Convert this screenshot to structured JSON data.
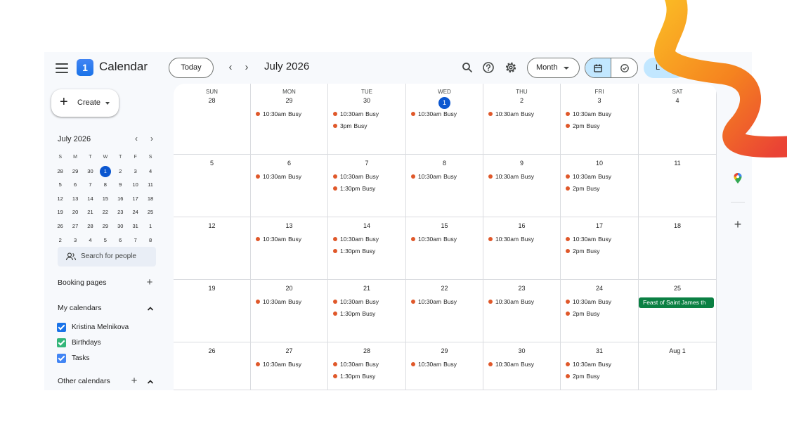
{
  "header": {
    "app_title": "Calendar",
    "logo_number": "1",
    "today_label": "Today",
    "period_label": "July 2026",
    "view_label": "Month",
    "account_initial": "L"
  },
  "sidebar": {
    "create_label": "Create",
    "mini_calendar": {
      "title": "July 2026",
      "weekdays": [
        "S",
        "M",
        "T",
        "W",
        "T",
        "F",
        "S"
      ],
      "weeks": [
        [
          "28",
          "29",
          "30",
          "1",
          "2",
          "3",
          "4"
        ],
        [
          "5",
          "6",
          "7",
          "8",
          "9",
          "10",
          "11"
        ],
        [
          "12",
          "13",
          "14",
          "15",
          "16",
          "17",
          "18"
        ],
        [
          "19",
          "20",
          "21",
          "22",
          "23",
          "24",
          "25"
        ],
        [
          "26",
          "27",
          "28",
          "29",
          "30",
          "31",
          "1"
        ],
        [
          "2",
          "3",
          "4",
          "5",
          "6",
          "7",
          "8"
        ]
      ],
      "selected": "1"
    },
    "search_people_placeholder": "Search for people",
    "booking_pages_label": "Booking pages",
    "my_calendars_label": "My calendars",
    "my_calendars": [
      {
        "name": "Kristina Melnikova",
        "color": "#1a73e8"
      },
      {
        "name": "Birthdays",
        "color": "#33b679"
      },
      {
        "name": "Tasks",
        "color": "#4285f4"
      }
    ],
    "other_calendars_label": "Other calendars"
  },
  "calendar": {
    "weekday_headers": [
      "SUN",
      "MON",
      "TUE",
      "WED",
      "THU",
      "FRI",
      "SAT"
    ],
    "weeks": [
      [
        {
          "day": "28",
          "events": []
        },
        {
          "day": "29",
          "events": [
            {
              "time": "10:30am",
              "title": "Busy"
            }
          ]
        },
        {
          "day": "30",
          "events": [
            {
              "time": "10:30am",
              "title": "Busy"
            },
            {
              "time": "3pm",
              "title": "Busy"
            }
          ]
        },
        {
          "day": "1",
          "today": true,
          "events": [
            {
              "time": "10:30am",
              "title": "Busy"
            }
          ]
        },
        {
          "day": "2",
          "events": [
            {
              "time": "10:30am",
              "title": "Busy"
            }
          ]
        },
        {
          "day": "3",
          "events": [
            {
              "time": "10:30am",
              "title": "Busy"
            },
            {
              "time": "2pm",
              "title": "Busy"
            }
          ]
        },
        {
          "day": "4",
          "events": []
        }
      ],
      [
        {
          "day": "5",
          "events": []
        },
        {
          "day": "6",
          "events": [
            {
              "time": "10:30am",
              "title": "Busy"
            }
          ]
        },
        {
          "day": "7",
          "events": [
            {
              "time": "10:30am",
              "title": "Busy"
            },
            {
              "time": "1:30pm",
              "title": "Busy"
            }
          ]
        },
        {
          "day": "8",
          "events": [
            {
              "time": "10:30am",
              "title": "Busy"
            }
          ]
        },
        {
          "day": "9",
          "events": [
            {
              "time": "10:30am",
              "title": "Busy"
            }
          ]
        },
        {
          "day": "10",
          "events": [
            {
              "time": "10:30am",
              "title": "Busy"
            },
            {
              "time": "2pm",
              "title": "Busy"
            }
          ]
        },
        {
          "day": "11",
          "events": []
        }
      ],
      [
        {
          "day": "12",
          "events": []
        },
        {
          "day": "13",
          "events": [
            {
              "time": "10:30am",
              "title": "Busy"
            }
          ]
        },
        {
          "day": "14",
          "events": [
            {
              "time": "10:30am",
              "title": "Busy"
            },
            {
              "time": "1:30pm",
              "title": "Busy"
            }
          ]
        },
        {
          "day": "15",
          "events": [
            {
              "time": "10:30am",
              "title": "Busy"
            }
          ]
        },
        {
          "day": "16",
          "events": [
            {
              "time": "10:30am",
              "title": "Busy"
            }
          ]
        },
        {
          "day": "17",
          "events": [
            {
              "time": "10:30am",
              "title": "Busy"
            },
            {
              "time": "2pm",
              "title": "Busy"
            }
          ]
        },
        {
          "day": "18",
          "events": []
        }
      ],
      [
        {
          "day": "19",
          "events": []
        },
        {
          "day": "20",
          "events": [
            {
              "time": "10:30am",
              "title": "Busy"
            }
          ]
        },
        {
          "day": "21",
          "events": [
            {
              "time": "10:30am",
              "title": "Busy"
            },
            {
              "time": "1:30pm",
              "title": "Busy"
            }
          ]
        },
        {
          "day": "22",
          "events": [
            {
              "time": "10:30am",
              "title": "Busy"
            }
          ]
        },
        {
          "day": "23",
          "events": [
            {
              "time": "10:30am",
              "title": "Busy"
            }
          ]
        },
        {
          "day": "24",
          "events": [
            {
              "time": "10:30am",
              "title": "Busy"
            },
            {
              "time": "2pm",
              "title": "Busy"
            }
          ]
        },
        {
          "day": "25",
          "events": [],
          "allday": "Feast of Saint James th"
        }
      ],
      [
        {
          "day": "26",
          "events": []
        },
        {
          "day": "27",
          "events": [
            {
              "time": "10:30am",
              "title": "Busy"
            }
          ]
        },
        {
          "day": "28",
          "events": [
            {
              "time": "10:30am",
              "title": "Busy"
            },
            {
              "time": "1:30pm",
              "title": "Busy"
            }
          ]
        },
        {
          "day": "29",
          "events": [
            {
              "time": "10:30am",
              "title": "Busy"
            }
          ]
        },
        {
          "day": "30",
          "events": [
            {
              "time": "10:30am",
              "title": "Busy"
            }
          ]
        },
        {
          "day": "31",
          "events": [
            {
              "time": "10:30am",
              "title": "Busy"
            },
            {
              "time": "2pm",
              "title": "Busy"
            }
          ]
        },
        {
          "day": "Aug 1",
          "events": []
        }
      ]
    ]
  },
  "icons": {
    "header": [
      "menu-icon",
      "search-icon",
      "help-icon",
      "settings-icon",
      "calendar-view-icon",
      "tasks-view-icon"
    ],
    "side_panel": [
      "maps-icon",
      "add-icon"
    ]
  },
  "colors": {
    "accent": "#0b57d0",
    "event_dot": "#e0582a",
    "allday_chip": "#0b8043",
    "active_toggle": "#c2e7ff",
    "swoosh": [
      "#fbbc25",
      "#f5831f",
      "#ea4335"
    ]
  }
}
